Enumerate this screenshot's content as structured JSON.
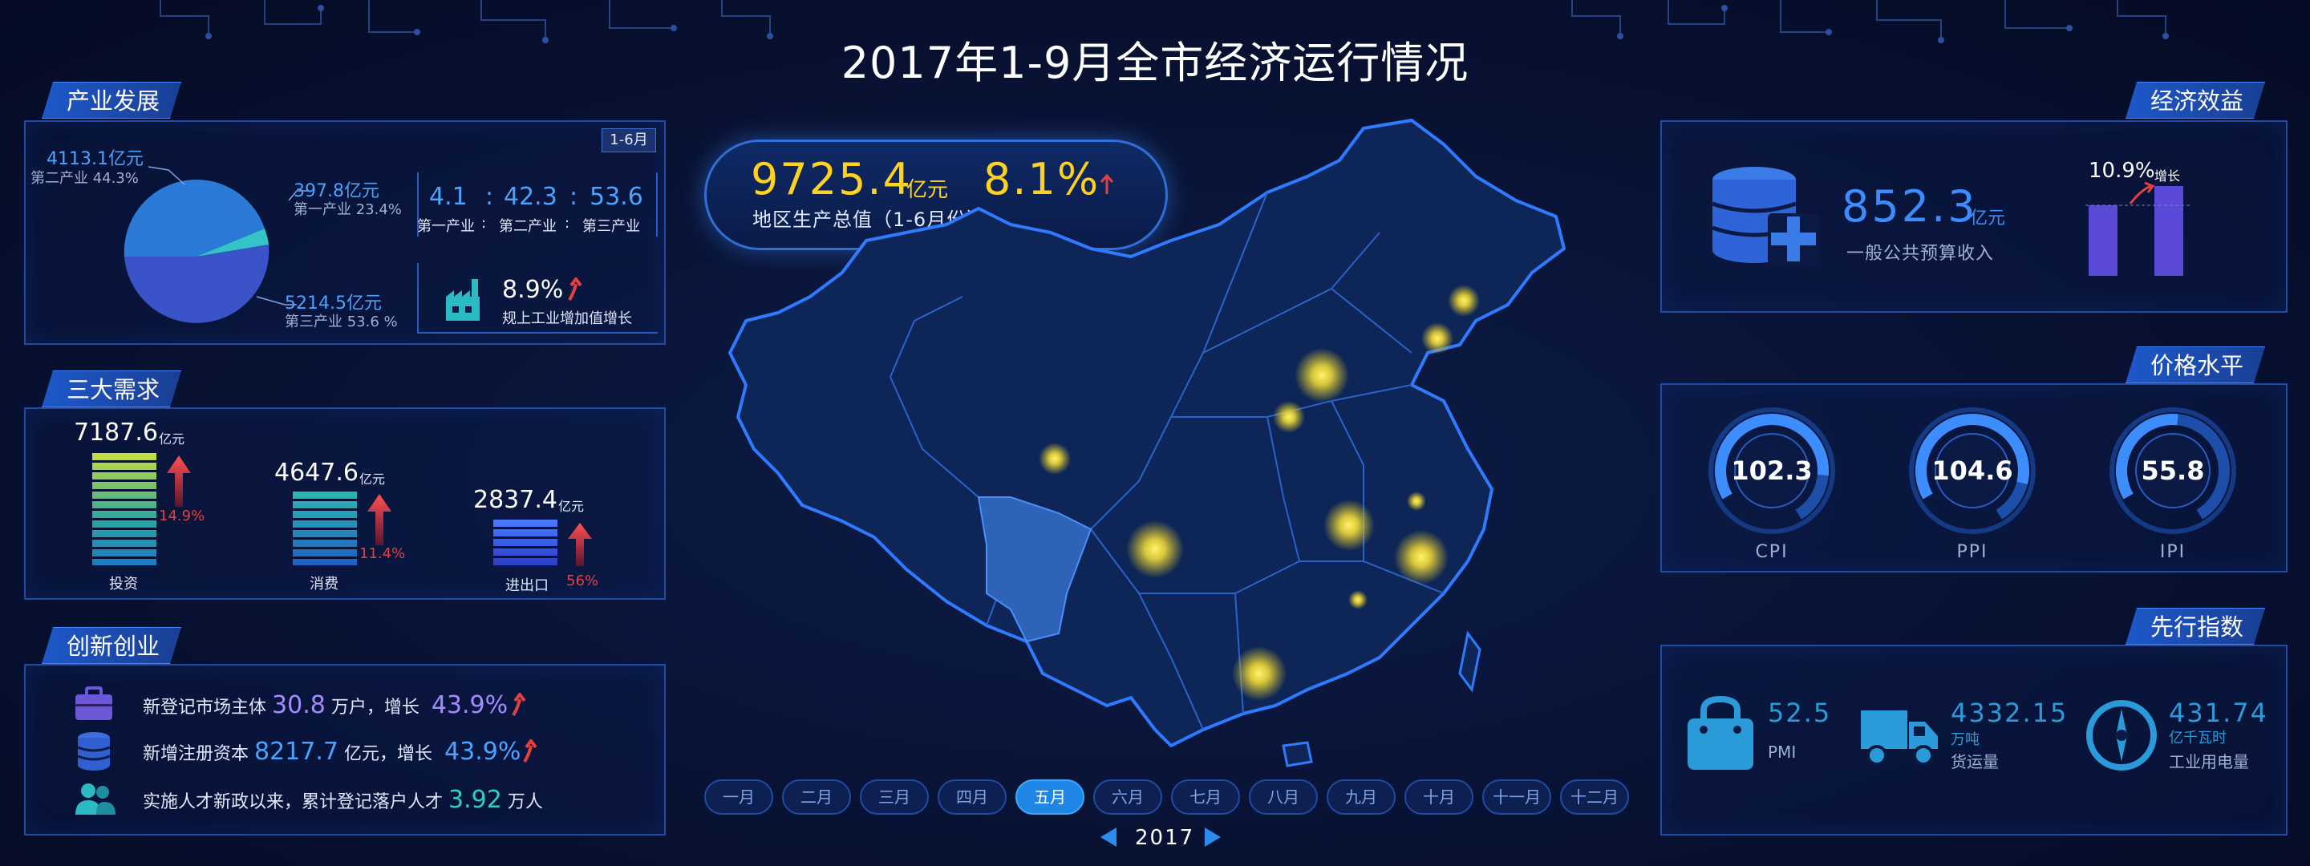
{
  "title": "2017年1-9月全市经济运行情况",
  "industry": {
    "heading": "产业发展",
    "badge": "1-6月",
    "secondary_value": "4113.1亿元",
    "secondary_label": "第二产业  44.3%",
    "primary_value": "397.8亿元",
    "primary_label": "第一产业  23.4%",
    "tertiary_value": "5214.5亿元",
    "tertiary_label": "第三产业  53.6 %",
    "ratio_a": "4.1",
    "ratio_b": "42.3",
    "ratio_c": "53.6",
    "ratio_sep": ":",
    "ratio_label_a": "第一产业",
    "ratio_label_b": "第二产业",
    "ratio_label_c": "第三产业",
    "growth_value": "8.9%",
    "growth_label": "规上工业增加值增长",
    "pie_shares": [
      44.3,
      2.1,
      53.6
    ]
  },
  "demand": {
    "heading": "三大需求",
    "unit": "亿元",
    "items": [
      {
        "value": "7187.6",
        "pct": "14.9%",
        "label": "投资"
      },
      {
        "value": "4647.6",
        "pct": "11.4%",
        "label": "消费"
      },
      {
        "value": "2837.4",
        "pct": "56%",
        "label": "进出口"
      }
    ]
  },
  "innovation": {
    "heading": "创新创业",
    "row1_prefix": "新登记市场主体",
    "row1_value": "30.8",
    "row1_unit": "万户，增长",
    "row1_pct": "43.9%",
    "row2_prefix": "新增注册资本",
    "row2_value": "8217.7",
    "row2_unit": "亿元，增长",
    "row2_pct": "43.9%",
    "row3_prefix": "实施人才新政以来，累计登记落户人才",
    "row3_value": "3.92",
    "row3_unit": "万人"
  },
  "gdp": {
    "value": "9725.4",
    "unit": "亿元",
    "growth": "8.1%",
    "label": "地区生产总值（1-6月份）"
  },
  "months": [
    "一月",
    "二月",
    "三月",
    "四月",
    "五月",
    "六月",
    "七月",
    "八月",
    "九月",
    "十月",
    "十一月",
    "十二月"
  ],
  "active_month": "五月",
  "year": "2017",
  "economy": {
    "heading": "经济效益",
    "value": "852.3",
    "unit": "亿元",
    "label": "一般公共预算收入",
    "growth": "10.9%",
    "growth_label": "增长"
  },
  "price": {
    "heading": "价格水平",
    "gauges": [
      {
        "name": "CPI",
        "value": "102.3"
      },
      {
        "name": "PPI",
        "value": "104.6"
      },
      {
        "name": "IPI",
        "value": "55.8"
      }
    ]
  },
  "leading": {
    "heading": "先行指数",
    "pmi_value": "52.5",
    "pmi_label": "PMI",
    "freight_value": "4332.15",
    "freight_unit": "万吨",
    "freight_label": "货运量",
    "power_value": "431.74",
    "power_unit": "亿千瓦时",
    "power_label": "工业用电量"
  },
  "colors": {
    "accent_blue": "#4aa3ff",
    "yellow": "#ffd21f",
    "red": "#e14141",
    "panel_border": "#1f4aa6"
  }
}
